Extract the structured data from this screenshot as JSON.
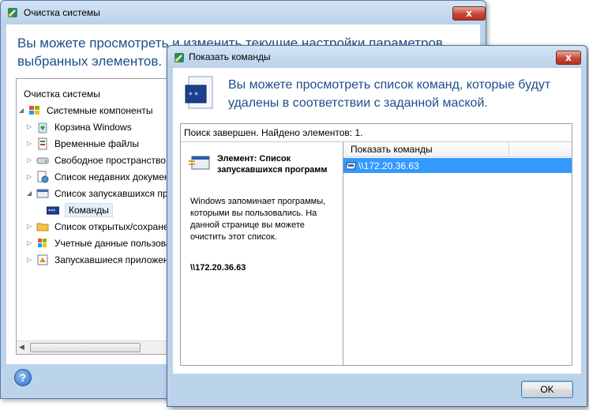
{
  "back_window": {
    "title": "Очистка системы",
    "close_label": "x",
    "header_text": "Вы можете просмотреть и изменить текущие настройки параметров выбранных элементов.",
    "tree": [
      {
        "label": "Очистка системы",
        "icon": "none",
        "level": 0
      },
      {
        "label": "Системные компоненты",
        "icon": "windows-logo-icon",
        "level": 0
      },
      {
        "label": "Корзина Windows",
        "icon": "recycle-bin-icon",
        "level": 1
      },
      {
        "label": "Временные файлы",
        "icon": "temp-files-icon",
        "level": 1
      },
      {
        "label": "Свободное пространство н",
        "icon": "disk-icon",
        "level": 1
      },
      {
        "label": "Список недавних документ",
        "icon": "recent-docs-icon",
        "level": 1
      },
      {
        "label": "Список запускавшихся пр",
        "icon": "run-list-icon",
        "level": 1
      },
      {
        "label": "Команды",
        "icon": "commands-icon",
        "level": 2
      },
      {
        "label": "Список открытых/сохране",
        "icon": "folder-icon",
        "level": 1
      },
      {
        "label": "Учетные данные пользова",
        "icon": "credentials-icon",
        "level": 1
      },
      {
        "label": "Запускавшиеся приложен",
        "icon": "apps-icon",
        "level": 1
      }
    ],
    "help_label": "?"
  },
  "dialog": {
    "title": "Показать команды",
    "close_label": "x",
    "header_text": "Вы можете просмотреть список команд, которые будут удалены в соответствии с заданной маской.",
    "status": "Поиск завершен. Найдено элементов: 1.",
    "info": {
      "title": "Элемент: Список запускавшихся программ",
      "description": "Windows запоминает программы, которыми вы пользовались. На данной странице вы можете очистить этот список.",
      "value": "\\\\172.20.36.63"
    },
    "list": {
      "column": "Показать команды",
      "rows": [
        "\\\\172.20.36.63"
      ]
    },
    "ok_label": "OK"
  },
  "colors": {
    "accent_text": "#1e4e8c",
    "selection": "#3399ff",
    "close_button": "#c7453a"
  }
}
